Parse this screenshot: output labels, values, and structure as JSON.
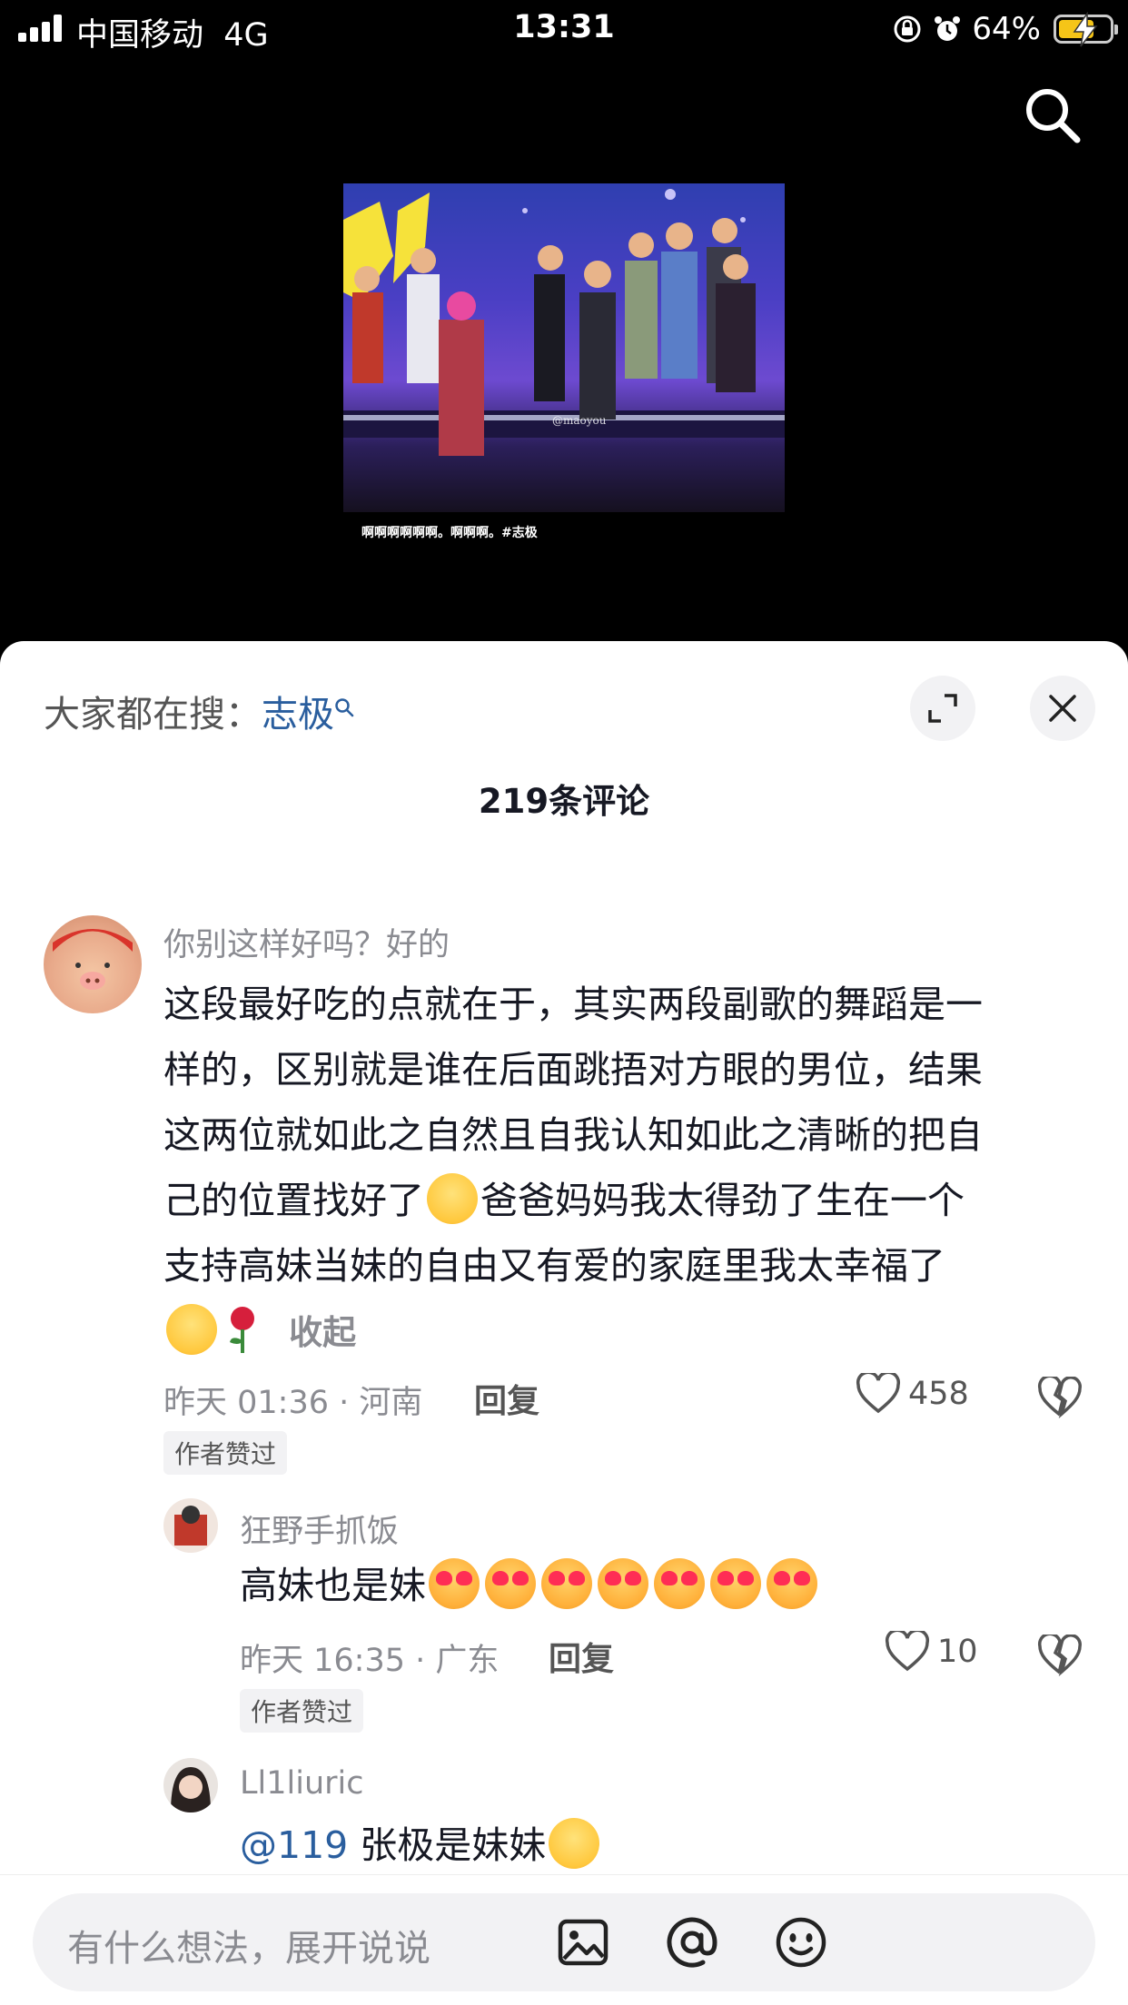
{
  "status_bar": {
    "carrier": "中国移动",
    "network": "4G",
    "time": "13:31",
    "battery": "64%"
  },
  "video": {
    "caption": "啊啊啊啊啊啊。啊啊啊。#志极",
    "watermark": "@maoyou"
  },
  "sheet": {
    "search_prefix": "大家都在搜：",
    "search_keyword": "志极",
    "title": "219条评论"
  },
  "comments": [
    {
      "username": "你别这样好吗？好的",
      "lines": [
        "这段最好吃的点就在于，其实两段副歌的舞蹈是一",
        "样的，区别就是谁在后面跳捂对方眼的男位，结果",
        "这两位就如此之自然且自我认知如此之清晰的把自",
        "己的位置找好了",
        "爸爸妈妈我太得劲了生在一个",
        "支持高妹当妹的自由又有爱的家庭里我太幸福了"
      ],
      "collapse": "收起",
      "meta": "昨天 01:36 · 河南",
      "reply": "回复",
      "likes": "458",
      "author_tag": "作者赞过"
    },
    {
      "username": "狂野手抓饭",
      "text": "高妹也是妹",
      "meta": "昨天 16:35 · 广东",
      "reply": "回复",
      "likes": "10",
      "author_tag": "作者赞过"
    },
    {
      "username": "Ll1liuric",
      "mention": "@119",
      "text": " 张极是妹妹"
    }
  ],
  "input": {
    "placeholder": "有什么想法，展开说说"
  },
  "colors": {
    "accent_link": "#2a5e9e",
    "sheet_bg": "#ffffff",
    "muted_text": "#8a8b91"
  }
}
